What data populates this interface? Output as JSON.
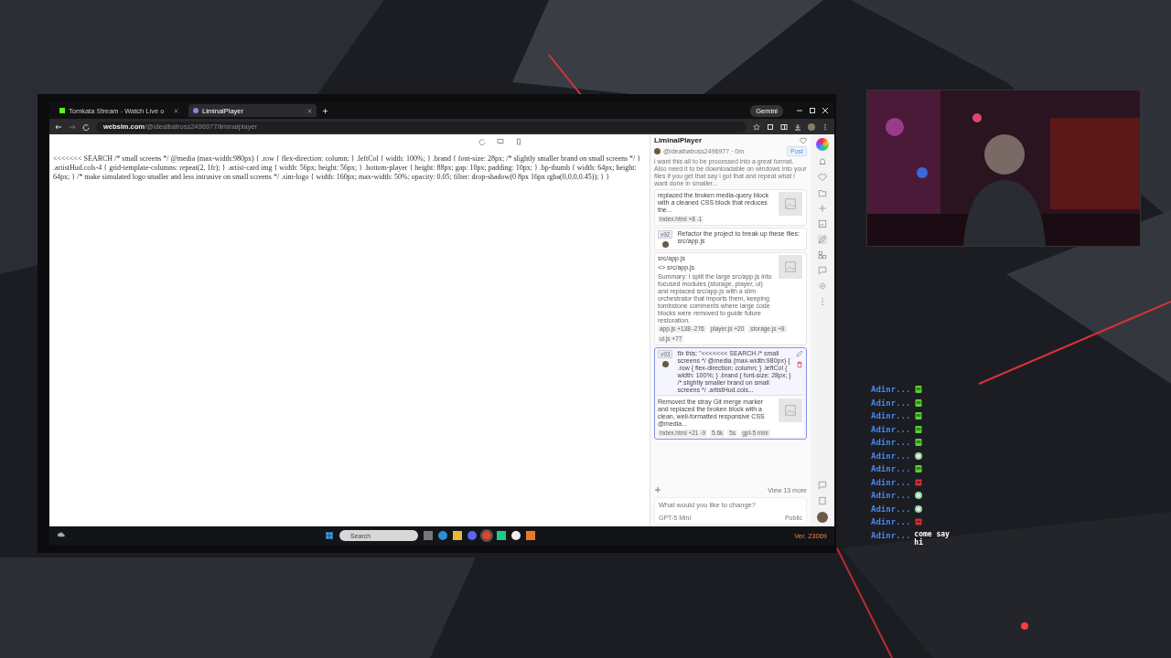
{
  "browser": {
    "tabs": [
      {
        "label": "Tomkata Stream - Watch Live o",
        "selected": false
      },
      {
        "label": "LiminalPlayer",
        "selected": true
      }
    ],
    "gemini": "Gemini",
    "url": {
      "host": "websim.com",
      "path": "/@idealbatross2496977/liminalplayer"
    }
  },
  "page": {
    "code": "<<<<<<< SEARCH /* small screens */ @media (max-width:980px) { .row { flex-direction: column; } .leftCol { width: 100%; } .brand { font-size: 28px; /* slightly smaller brand on small screens */ } .artistHud.cols-4 { grid-template-columns: repeat(2, 1fr); } .artist-card img { width: 56px; height: 56px; } .bottom-player { height: 88px; gap: 10px; padding: 10px; } .bp-thumb { width: 64px; height: 64px; } /* make simulated logo smaller and less intrusive on small screens */ .sim-logo { width: 160px; max-width: 50%; opacity: 0.05; filter: drop-shadow(0 8px 16px rgba(0,0,0,0.45)); } }"
  },
  "panel": {
    "title": "LiminalPlayer",
    "author": "@idealbatross2496977 · 0m",
    "post": "Post",
    "prompt": "i want this all to be processed into a great format. Also need it to be downloadable on windows into your files if you get that say i got that and repeat what i want done in smaller...",
    "cards": [
      {
        "kind": "reply",
        "text": "replaced the broken media-query block with a cleaned CSS block that reduces the...",
        "tags": [
          "index.html +8 -1"
        ],
        "selected": false
      },
      {
        "kind": "prompt",
        "version": "v92",
        "text": "Refactor the project to break up these files: src/app.js",
        "selected": false
      },
      {
        "kind": "file",
        "file": "src/app.js",
        "code": "<> src/app.js",
        "text": "Summary: I split the large src/app.js into focused modules (storage, player, ui) and replaced src/app.js with a slim orchestrator that imports them, keeping tombstone comments where large code blocks were removed to guide future restoration.",
        "tags": [
          "app.js +138 -276",
          "player.js +20",
          "storage.js +8",
          "ui.js +77"
        ],
        "selected": false
      },
      {
        "kind": "exchange",
        "version": "v93",
        "text": "fix this: \"<<<<<<< SEARCH /* small screens */ @media (max-width:980px) { .row { flex-direction: column; } .leftCol { width: 100%; } .brand { font-size: 28px; } /* slightly smaller brand on small screens */ .artistHud.cols...",
        "reply": "Removed the stray Git merge marker and replaced the broken block with a clean, well-formatted responsive CSS @media...",
        "tags": [
          "index.html +21 -9",
          "5.6k",
          "5s",
          "gpt-5 mini"
        ],
        "selected": true
      }
    ],
    "more": "View 13 more",
    "input": {
      "placeholder": "What would you like to change?"
    },
    "model": "GPT-5 Mini",
    "visibility": "Public"
  },
  "taskbar": {
    "search": "Search",
    "version": "Ver. 23069"
  },
  "chat": [
    {
      "user": "Adinr...",
      "kind": "cup"
    },
    {
      "user": "Adinr...",
      "kind": "cup"
    },
    {
      "user": "Adinr...",
      "kind": "cup"
    },
    {
      "user": "Adinr...",
      "kind": "cup"
    },
    {
      "user": "Adinr...",
      "kind": "cup"
    },
    {
      "user": "Adinr...",
      "kind": "ball"
    },
    {
      "user": "Adinr...",
      "kind": "cup"
    },
    {
      "user": "Adinr...",
      "kind": "face"
    },
    {
      "user": "Adinr...",
      "kind": "ball"
    },
    {
      "user": "Adinr...",
      "kind": "ball"
    },
    {
      "user": "Adinr...",
      "kind": "face"
    },
    {
      "user": "Adinr...",
      "kind": "text",
      "message": "come say hi"
    }
  ]
}
